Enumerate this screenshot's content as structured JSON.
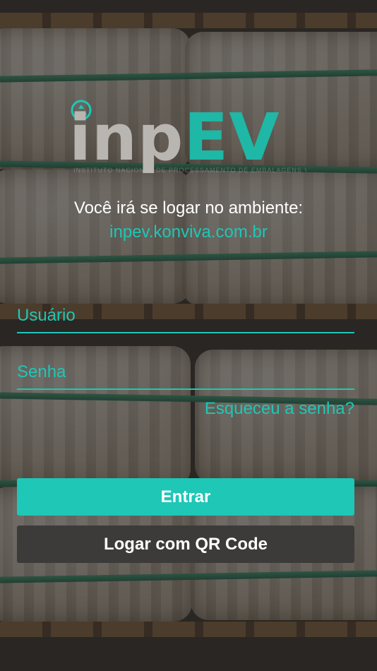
{
  "brand": {
    "logo_text_gray": "inp",
    "logo_text_color": "EV",
    "tagline": "INSTITUTO NACIONAL DE PROCESSAMENTO DE EMBALAGENS VAZIAS",
    "logo_icon": "recycle-icon",
    "gray_color": "#b9b5b0",
    "accent_color": "#1ec7b6"
  },
  "login": {
    "intro_text": "Você irá se logar no ambiente:",
    "environment_url": "inpev.konviva.com.br",
    "username_placeholder": "Usuário",
    "password_placeholder": "Senha",
    "forgot_password_label": "Esqueceu a senha?",
    "submit_label": "Entrar",
    "qr_login_label": "Logar com QR Code",
    "qr_button_color": "#3c3b3a"
  }
}
